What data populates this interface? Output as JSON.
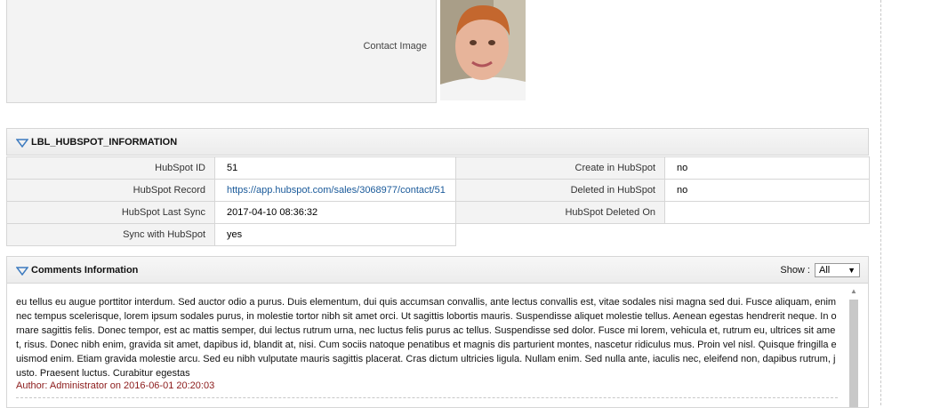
{
  "contact_image": {
    "label": "Contact Image"
  },
  "hubspot_panel": {
    "title": "LBL_HUBSPOT_INFORMATION",
    "rows": [
      {
        "label1": "HubSpot ID",
        "value1": "51",
        "label2": "Create in HubSpot",
        "value2": "no"
      },
      {
        "label1": "HubSpot Record",
        "value1": "https://app.hubspot.com/sales/3068977/contact/51",
        "label2": "Deleted in HubSpot",
        "value2": "no"
      },
      {
        "label1": "HubSpot Last Sync",
        "value1": "2017-04-10 08:36:32",
        "label2": "HubSpot Deleted On",
        "value2": ""
      },
      {
        "label1": "Sync with HubSpot",
        "value1": "yes"
      }
    ]
  },
  "comments_panel": {
    "title": "Comments Information",
    "show_label": "Show :",
    "show_value": "All",
    "comment_text": "eu tellus eu augue porttitor interdum. Sed auctor odio a purus. Duis elementum, dui quis accumsan convallis, ante lectus convallis est, vitae sodales nisi magna sed dui. Fusce aliquam, enim nec tempus scelerisque, lorem ipsum sodales purus, in molestie tortor nibh sit amet orci. Ut sagittis lobortis mauris. Suspendisse aliquet molestie tellus. Aenean egestas hendrerit neque. In ornare sagittis felis. Donec tempor, est ac mattis semper, dui lectus rutrum urna, nec luctus felis purus ac tellus. Suspendisse sed dolor. Fusce mi lorem, vehicula et, rutrum eu, ultrices sit amet, risus. Donec nibh enim, gravida sit amet, dapibus id, blandit at, nisi. Cum sociis natoque penatibus et magnis dis parturient montes, nascetur ridiculus mus. Proin vel nisl. Quisque fringilla euismod enim. Etiam gravida molestie arcu. Sed eu nibh vulputate mauris sagittis placerat. Cras dictum ultricies ligula. Nullam enim. Sed nulla ante, iaculis nec, eleifend non, dapibus rutrum, justo. Praesent luctus. Curabitur egestas",
    "comment_author": "Author: Administrator on 2016-06-01 20:20:03"
  },
  "colors": {
    "link": "#1a5a9a",
    "author": "#8b1a1a",
    "panel_bg": "#f3f3f3",
    "triangle": "#3d7bbf"
  }
}
